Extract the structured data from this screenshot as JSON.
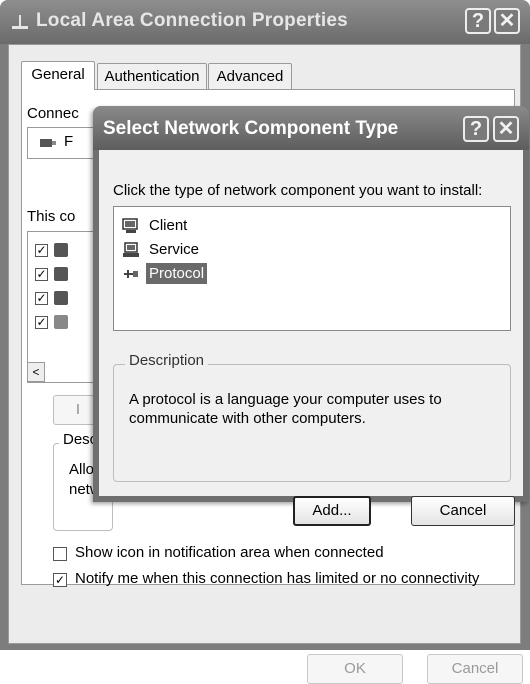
{
  "back_window": {
    "title": "Local Area Connection Properties",
    "help_glyph": "?",
    "close_glyph": "✕",
    "tabs": [
      {
        "label": "General",
        "active": true
      },
      {
        "label": "Authentication",
        "active": false
      },
      {
        "label": "Advanced",
        "active": false
      }
    ],
    "connect_using_label": "Connec",
    "adapter_name": "F",
    "this_connection_label": "This co",
    "scroll_left_glyph": "<",
    "install_button_label": "I",
    "description_legend": "Descr",
    "description_text_line1": "Allow",
    "description_text_line2": "netw",
    "show_icon_label": "Show icon in notification area when connected",
    "notify_label": "Notify me when this connection has limited or no connectivity",
    "notify_checked": true,
    "show_icon_checked": false,
    "ok_label": "OK",
    "cancel_label": "Cancel"
  },
  "dialog": {
    "title": "Select Network Component Type",
    "help_glyph": "?",
    "close_glyph": "✕",
    "instruction": "Click the type of network component you want to install:",
    "components": [
      {
        "label": "Client",
        "icon": "client-icon",
        "selected": false
      },
      {
        "label": "Service",
        "icon": "service-icon",
        "selected": false
      },
      {
        "label": "Protocol",
        "icon": "protocol-icon",
        "selected": true
      }
    ],
    "description_legend": "Description",
    "description_text": "A protocol is a language your computer uses to communicate with other computers.",
    "add_label": "Add...",
    "cancel_label": "Cancel"
  }
}
